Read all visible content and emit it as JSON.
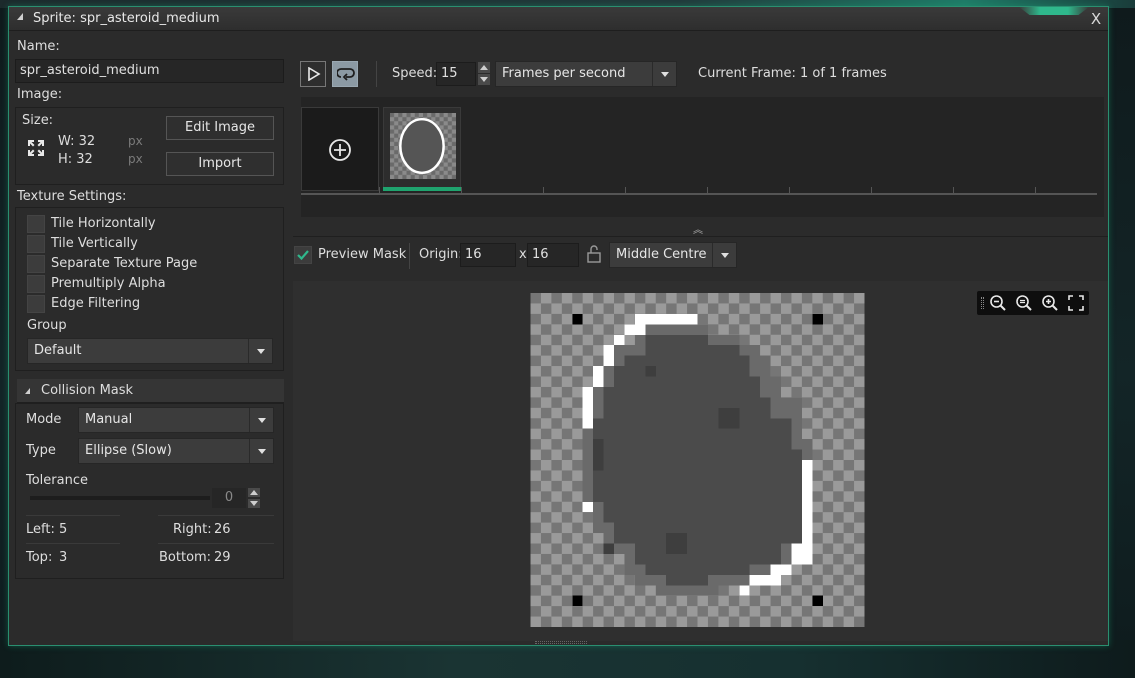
{
  "window": {
    "title": "Sprite: spr_asteroid_medium",
    "close_glyph": "X"
  },
  "left": {
    "name_label": "Name:",
    "name_value": "spr_asteroid_medium",
    "image_label": "Image:",
    "size_label": "Size:",
    "width": "W: 32",
    "height": "H: 32",
    "px_1": "px",
    "px_2": "px",
    "edit_image": "Edit Image",
    "import": "Import",
    "texture_label": "Texture Settings:",
    "texture_options": [
      {
        "label": "Tile Horizontally",
        "checked": false
      },
      {
        "label": "Tile Vertically",
        "checked": false
      },
      {
        "label": "Separate Texture Page",
        "checked": false
      },
      {
        "label": "Premultiply Alpha",
        "checked": false
      },
      {
        "label": "Edge Filtering",
        "checked": false
      }
    ],
    "group_label": "Group",
    "group_value": "Default"
  },
  "collision": {
    "header": "Collision Mask",
    "mode_label": "Mode",
    "mode_value": "Manual",
    "type_label": "Type",
    "type_value": "Ellipse (Slow)",
    "tolerance_label": "Tolerance",
    "tolerance_value": "0",
    "left_label": "Left:",
    "left_value": "5",
    "right_label": "Right:",
    "right_value": "26",
    "top_label": "Top:",
    "top_value": "3",
    "bottom_label": "Bottom:",
    "bottom_value": "29"
  },
  "toolbar": {
    "speed_label": "Speed:",
    "speed_value": "15",
    "speed_unit": "Frames per second",
    "current_frame": "Current Frame: 1 of 1 frames"
  },
  "preview": {
    "preview_mask_label": "Preview Mask",
    "preview_mask_checked": true,
    "origin_label": "Origin:",
    "origin_x": "16",
    "origin_sep": "x",
    "origin_y": "16",
    "origin_preset": "Middle Centre"
  },
  "colors": {
    "accent": "#2a8f70",
    "frame_selected": "#1fa36e",
    "checkmark": "#2fb88c"
  }
}
